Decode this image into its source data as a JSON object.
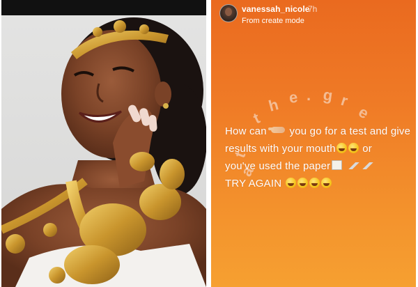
{
  "photo": {
    "description_icon": "woman-photo"
  },
  "story": {
    "username": "vanessah_nicole",
    "time": "7h",
    "subtitle": "From create mode",
    "watermark_letters": [
      "t",
      "h",
      "e",
      ".",
      "g",
      "r",
      "e",
      "a",
      "t"
    ],
    "text_lines": [
      [
        "How can ",
        "point",
        " you go for a test  and give"
      ],
      [
        "results with your mouth",
        "laugh",
        "laugh",
        " or"
      ],
      [
        "you've used the paper",
        "doc",
        " ",
        "tool",
        "tool"
      ],
      [
        "TRY AGAIN ",
        "laugh",
        "laugh",
        "laugh",
        "laugh"
      ]
    ],
    "background_colors": [
      "#ea6a1f",
      "#f6a031"
    ]
  }
}
